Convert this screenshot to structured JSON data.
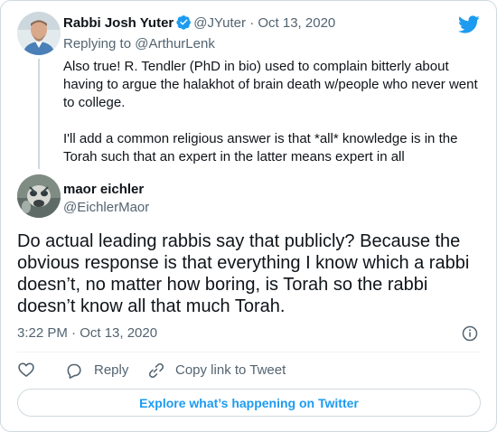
{
  "parent": {
    "name": "Rabbi Josh Yuter",
    "handle": "@JYuter",
    "separator": "·",
    "date": "Oct 13, 2020",
    "replying_prefix": "Replying to ",
    "replying_to": "@ArthurLenk",
    "paragraphs": [
      "Also true! R. Tendler (PhD in bio) used to complain bitterly about having to argue the halakhot of brain death w/people who never went to college.",
      "I'll add a common religious answer is that *all* knowledge is in the Torah such that an expert in the latter means expert in all"
    ]
  },
  "tweet": {
    "name": "maor eichler",
    "handle": "@EichlerMaor",
    "text": "Do actual leading rabbis say that publicly? Because the obvious response is that everything I know which a rabbi doesn’t, no matter how boring, is Torah so the rabbi doesn’t know all that much Torah.",
    "timestamp": "3:22 PM · Oct 13, 2020"
  },
  "actions": {
    "like_icon": "heart-icon",
    "reply_label": "Reply",
    "reply_icon": "speech-bubble-icon",
    "copy_label": "Copy link to Tweet",
    "copy_icon": "link-icon"
  },
  "explore_label": "Explore what’s happening on Twitter",
  "colors": {
    "brand_blue": "#1d9bf0",
    "text": "#0f1419",
    "muted": "#536471",
    "border": "#cfd9de"
  }
}
